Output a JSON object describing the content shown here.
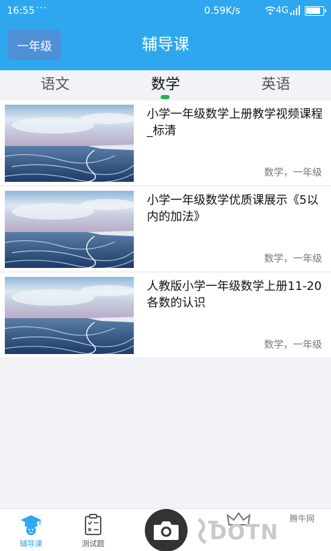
{
  "status_bar": {
    "time": "16:55",
    "dots": "···",
    "speed": "0.59K/s",
    "network": "4G",
    "battery_level": 0.9
  },
  "header": {
    "grade_button": "一年级",
    "title": "辅导课"
  },
  "tabs": [
    {
      "label": "语文",
      "active": false
    },
    {
      "label": "数学",
      "active": true
    },
    {
      "label": "英语",
      "active": false
    }
  ],
  "courses": [
    {
      "title": "小学一年级数学上册教学视频课程_标清",
      "meta": "数学，一年级"
    },
    {
      "title": "小学一年级数学优质课展示《5以内的加法》",
      "meta": "数学，一年级"
    },
    {
      "title": "人教版小学一年级数学上册11-20各数的认识",
      "meta": "数学，一年级"
    }
  ],
  "bottom_nav": [
    {
      "label": "辅导课",
      "icon": "graduate-icon",
      "active": true
    },
    {
      "label": "测试题",
      "icon": "clipboard-icon",
      "active": false
    }
  ],
  "watermark": {
    "text": "DOTN",
    "small": "腾牛网"
  },
  "colors": {
    "primary": "#2fa7ee",
    "grade_button": "#4f8fd6",
    "tab_indicator": "#1fb55a"
  }
}
